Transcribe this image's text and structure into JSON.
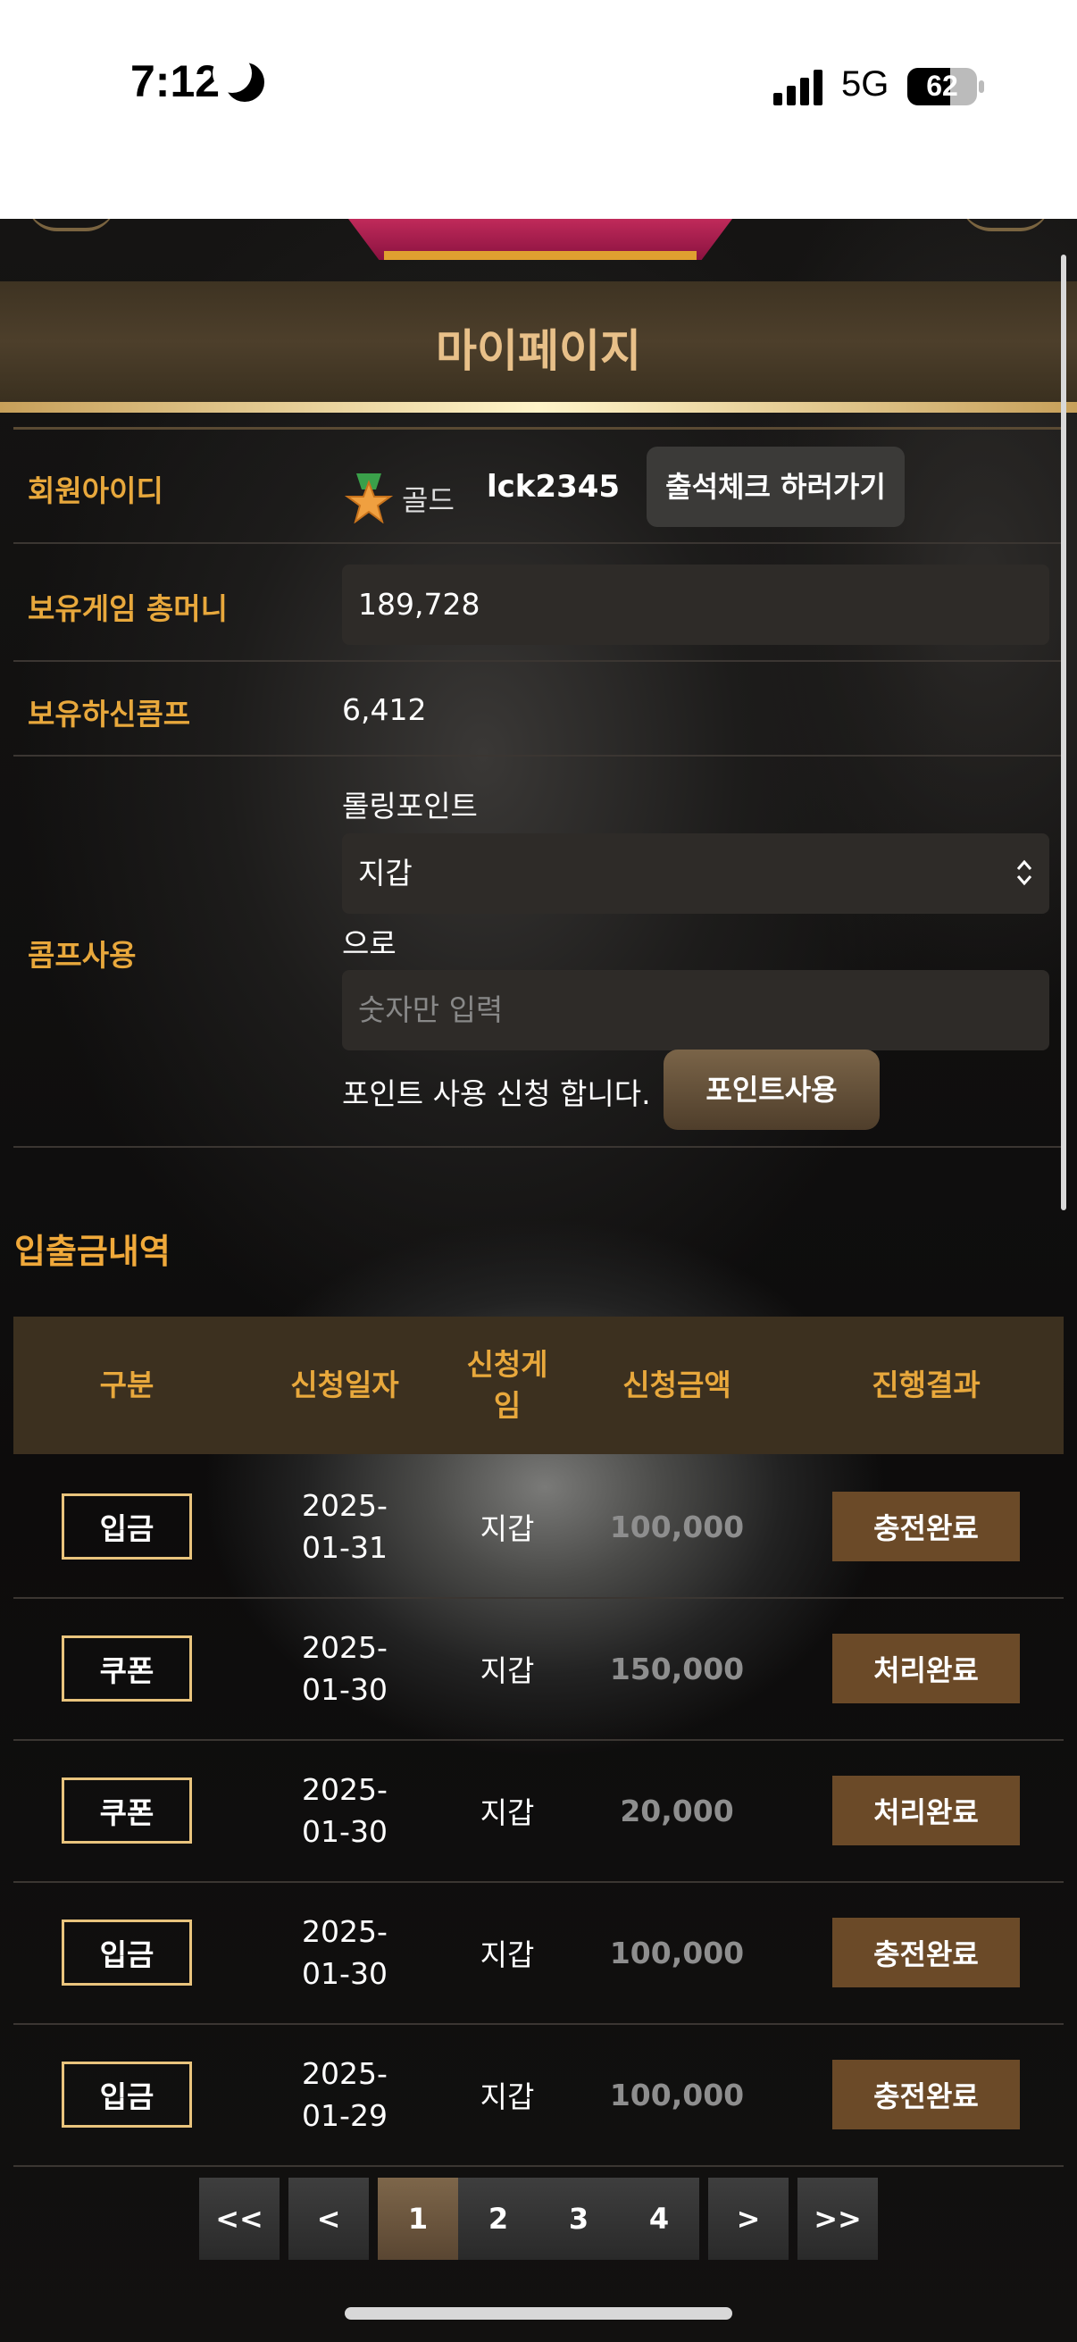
{
  "status_bar": {
    "time": "7:12",
    "network": "5G",
    "battery": "62",
    "battery_level": 0.62
  },
  "page": {
    "title": "마이페이지"
  },
  "member": {
    "id_label": "회원아이디",
    "grade": "골드",
    "user_id": "lck2345",
    "attendance_button": "출석체크 하러가기"
  },
  "money": {
    "label": "보유게임 총머니",
    "value": "189,728"
  },
  "comp": {
    "label": "보유하신콤프",
    "value": "6,412"
  },
  "comp_use": {
    "label": "콤프사용",
    "rolling_label": "롤링포인트",
    "select_value": "지갑",
    "to_label": "으로",
    "amount_placeholder": "숫자만 입력",
    "apply_text": "포인트 사용 신청 합니다.",
    "apply_button": "포인트사용"
  },
  "history": {
    "title": "입출금내역",
    "headers": [
      "구분",
      "신청일자",
      "신청게임",
      "신청금액",
      "진행결과"
    ],
    "header_game_line1": "신청게",
    "header_game_line2": "임",
    "rows": [
      {
        "type": "입금",
        "date1": "2025-",
        "date2": "01-31",
        "game": "지갑",
        "amount": "100,000",
        "result": "충전완료"
      },
      {
        "type": "쿠폰",
        "date1": "2025-",
        "date2": "01-30",
        "game": "지갑",
        "amount": "150,000",
        "result": "처리완료"
      },
      {
        "type": "쿠폰",
        "date1": "2025-",
        "date2": "01-30",
        "game": "지갑",
        "amount": "20,000",
        "result": "처리완료"
      },
      {
        "type": "입금",
        "date1": "2025-",
        "date2": "01-30",
        "game": "지갑",
        "amount": "100,000",
        "result": "충전완료"
      },
      {
        "type": "입금",
        "date1": "2025-",
        "date2": "01-29",
        "game": "지갑",
        "amount": "100,000",
        "result": "충전완료"
      }
    ]
  },
  "pagination": {
    "first": "<<",
    "prev": "<",
    "pages": [
      "1",
      "2",
      "3",
      "4"
    ],
    "current": "1",
    "next": ">",
    "last": ">>"
  },
  "colors": {
    "accent_gold": "#e8a83c",
    "title_text": "#e8c089",
    "result_bg": "#6b4a28",
    "type_border": "#e9c47d"
  },
  "icons": {
    "grade_icon": "star-medal-icon",
    "select_icon": "chevron-updown-icon",
    "moon_icon": "moon-icon"
  }
}
